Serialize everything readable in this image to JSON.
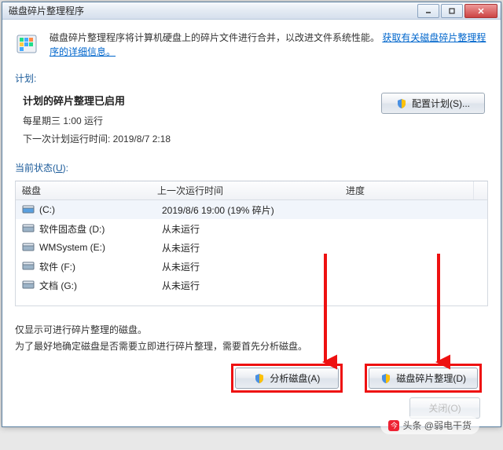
{
  "title": "磁盘碎片整理程序",
  "info": {
    "text": "磁盘碎片整理程序将计算机硬盘上的碎片文件进行合并，以改进文件系统性能。",
    "link": "获取有关磁盘碎片整理程序的详细信息。"
  },
  "sections": {
    "schedule_label": "计划:",
    "status_label": "当前状态(U):"
  },
  "schedule": {
    "title": "计划的碎片整理已启用",
    "line1": "每星期三  1:00 运行",
    "line2": "下一次计划运行时间: 2019/8/7 2:18",
    "config_btn": "配置计划(S)..."
  },
  "table": {
    "headers": {
      "disk": "磁盘",
      "last": "上一次运行时间",
      "progress": "进度"
    },
    "rows": [
      {
        "icon_type": "c",
        "name": "(C:)",
        "last": "2019/8/6 19:00 (19% 碎片)"
      },
      {
        "icon_type": "hdd",
        "name": "软件固态盘 (D:)",
        "last": "从未运行"
      },
      {
        "icon_type": "hdd",
        "name": "WMSystem (E:)",
        "last": "从未运行"
      },
      {
        "icon_type": "hdd",
        "name": "软件 (F:)",
        "last": "从未运行"
      },
      {
        "icon_type": "hdd",
        "name": "文档 (G:)",
        "last": "从未运行"
      }
    ]
  },
  "hint": {
    "line1": "仅显示可进行碎片整理的磁盘。",
    "line2": "为了最好地确定磁盘是否需要立即进行碎片整理，需要首先分析磁盘。"
  },
  "buttons": {
    "analyze": "分析磁盘(A)",
    "defrag": "磁盘碎片整理(D)",
    "close": "关闭(O)"
  },
  "watermark": "头条 @弱电干货"
}
